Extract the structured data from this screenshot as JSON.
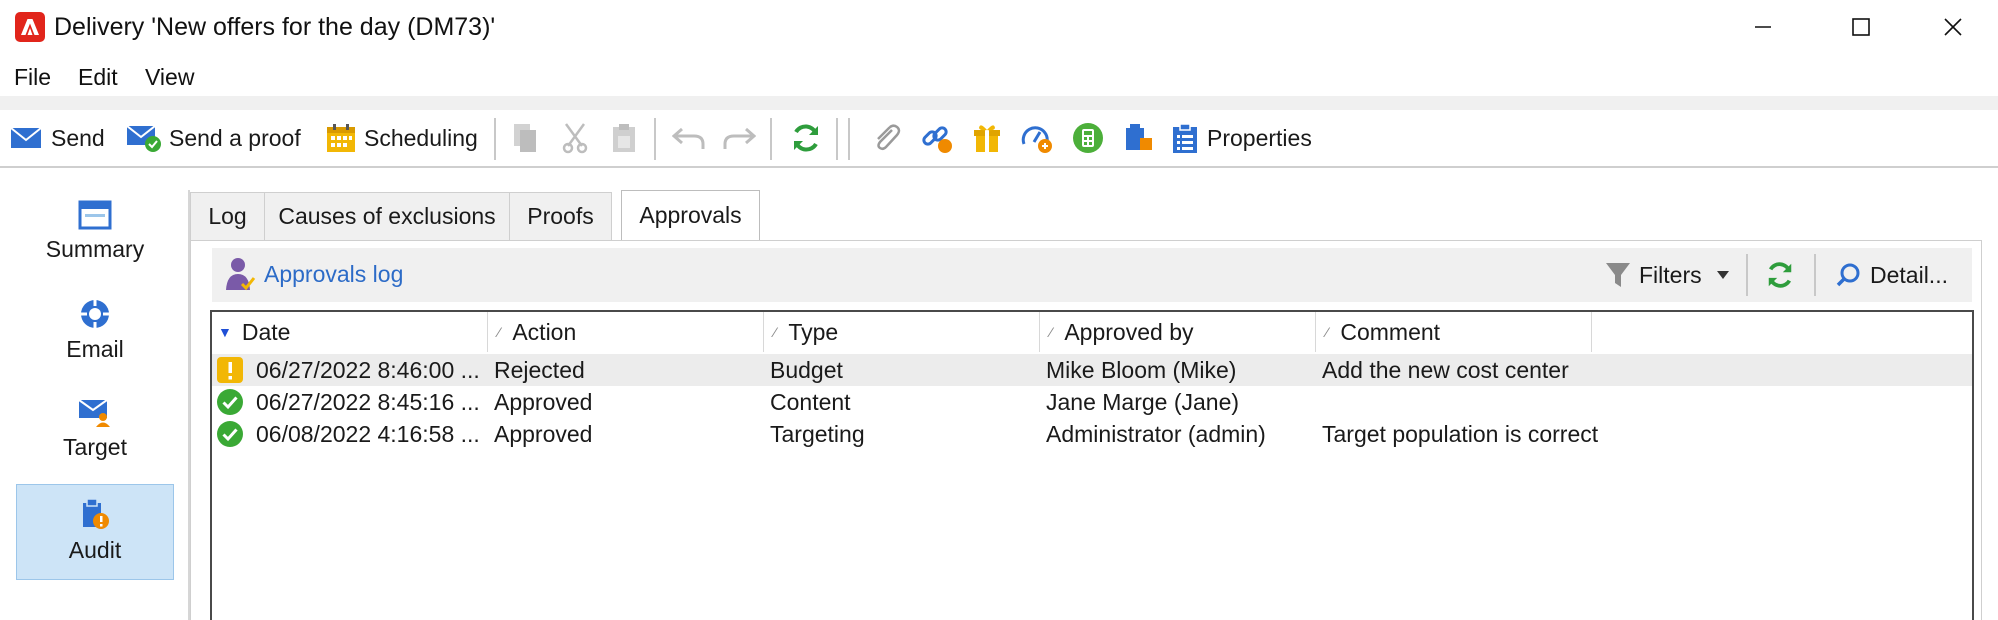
{
  "window": {
    "title": "Delivery 'New offers for the day (DM73)'",
    "app_icon": "adobe-campaign-icon"
  },
  "menu": [
    "File",
    "Edit",
    "View"
  ],
  "toolbar": {
    "send_label": "Send",
    "send_proof_label": "Send a proof",
    "scheduling_label": "Scheduling",
    "properties_label": "Properties"
  },
  "nav": {
    "items": [
      {
        "label": "Summary",
        "icon": "summary-icon"
      },
      {
        "label": "Email",
        "icon": "email-channel-icon"
      },
      {
        "label": "Target",
        "icon": "target-icon"
      },
      {
        "label": "Audit",
        "icon": "audit-icon",
        "active": true
      }
    ]
  },
  "tabs": [
    {
      "label": "Log"
    },
    {
      "label": "Causes of exclusions"
    },
    {
      "label": "Proofs"
    },
    {
      "label": "Approvals",
      "active": true
    }
  ],
  "approvals": {
    "link_label": "Approvals log",
    "filters_label": "Filters",
    "detail_label": "Detail..."
  },
  "grid": {
    "columns": [
      "Date",
      "Action",
      "Type",
      "Approved by",
      "Comment"
    ],
    "rows": [
      {
        "status": "warning",
        "date": "06/27/2022 8:46:00 ...",
        "action": "Rejected",
        "type": "Budget",
        "approved_by": "Mike Bloom (Mike)",
        "comment": "Add the new cost center",
        "selected": true
      },
      {
        "status": "ok",
        "date": "06/27/2022 8:45:16 ...",
        "action": "Approved",
        "type": "Content",
        "approved_by": "Jane Marge (Jane)",
        "comment": ""
      },
      {
        "status": "ok",
        "date": "06/08/2022 4:16:58 ...",
        "action": "Approved",
        "type": "Targeting",
        "approved_by": "Administrator (admin)",
        "comment": "Target population is correct"
      }
    ]
  },
  "colors": {
    "accent_blue": "#2c6bc7",
    "nav_active_bg": "#cde4f7",
    "ok_green": "#3aa935",
    "warning_yellow": "#f2b705",
    "refresh_green": "#2e9d3c"
  }
}
